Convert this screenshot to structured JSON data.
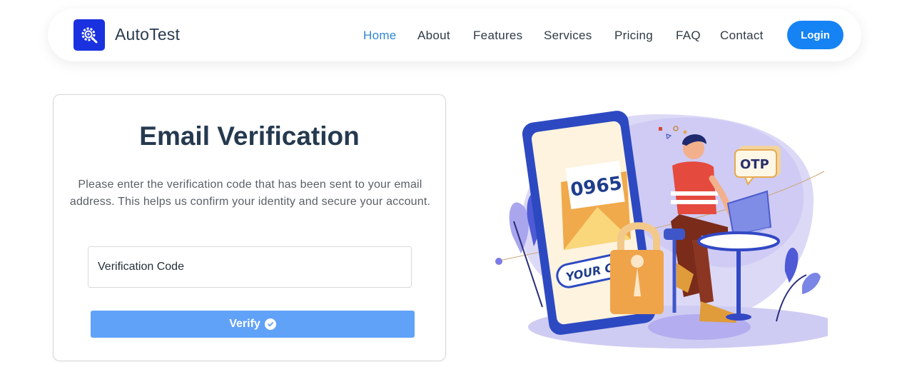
{
  "brand": {
    "name": "AutoTest",
    "logo_icon": "gear-search-icon",
    "logo_color": "#1a31e0"
  },
  "nav": {
    "items": [
      {
        "label": "Home",
        "active": true
      },
      {
        "label": "About",
        "active": false
      },
      {
        "label": "Features",
        "active": false
      },
      {
        "label": "Services",
        "active": false
      },
      {
        "label": "Pricing",
        "active": false
      },
      {
        "label": "FAQ",
        "active": false
      },
      {
        "label": "Contact",
        "active": false
      }
    ],
    "login_label": "Login",
    "active_color": "#2f86d6",
    "login_color": "#1683f4"
  },
  "verification": {
    "title": "Email Verification",
    "description": "Please enter the verification code that has been sent to your email address. This helps us confirm your identity and secure your account.",
    "input_placeholder": "Verification Code",
    "input_value": "",
    "verify_label": "Verify",
    "verify_icon": "check-circle-icon",
    "button_color": "#61a2f9"
  },
  "illustration": {
    "envelope_code": "0965",
    "phone_banner": "YOUR CODE",
    "bubble_text": "OTP"
  }
}
